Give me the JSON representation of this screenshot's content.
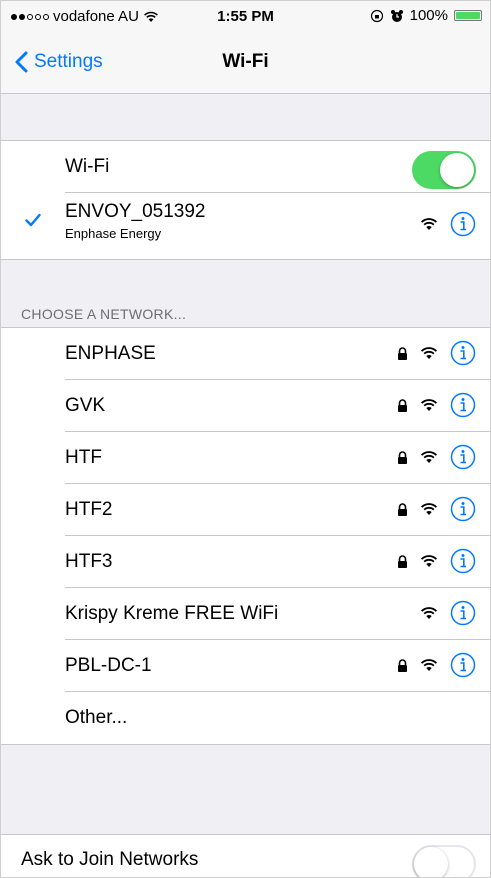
{
  "status": {
    "carrier": "vodafone AU",
    "time": "1:55 PM",
    "battery": "100%"
  },
  "nav": {
    "back_label": "Settings",
    "title": "Wi-Fi"
  },
  "wifi_toggle": {
    "label": "Wi-Fi",
    "on": true
  },
  "connected": {
    "name": "ENVOY_051392",
    "subtitle": "Enphase Energy"
  },
  "section_header": "CHOOSE A NETWORK...",
  "networks": [
    {
      "name": "ENPHASE",
      "locked": true
    },
    {
      "name": "GVK",
      "locked": true
    },
    {
      "name": "HTF",
      "locked": true
    },
    {
      "name": "HTF2",
      "locked": true
    },
    {
      "name": "HTF3",
      "locked": true
    },
    {
      "name": "Krispy Kreme FREE WiFi",
      "locked": false
    },
    {
      "name": "PBL-DC-1",
      "locked": true
    }
  ],
  "other_label": "Other...",
  "ask_to_join": {
    "label": "Ask to Join Networks",
    "on": false
  },
  "colors": {
    "accent": "#007aff",
    "toggle_on": "#4cd964"
  }
}
